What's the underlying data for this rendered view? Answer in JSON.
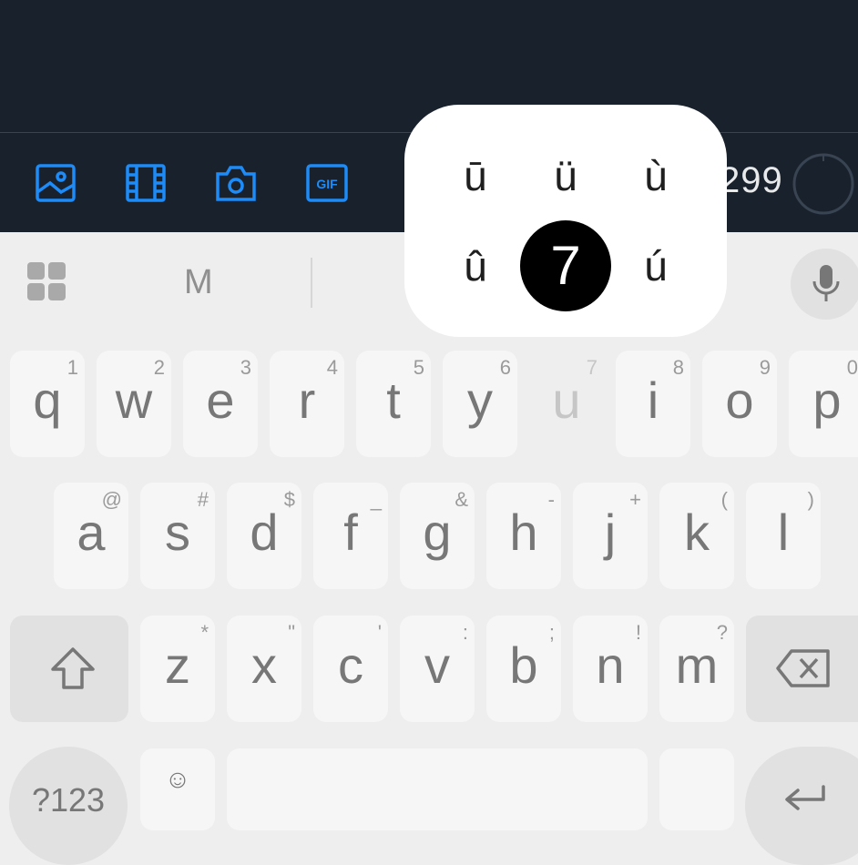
{
  "compose": {
    "char_count": "299",
    "icons": [
      "image-icon",
      "video-icon",
      "camera-icon",
      "gif-icon"
    ],
    "gif_label": "GIF"
  },
  "keyboard": {
    "suggestion": "M",
    "popup": {
      "alternates_top": [
        "ū",
        "ü",
        "ù"
      ],
      "alternates_bottom": [
        "û",
        "7",
        "ú"
      ],
      "selected": "7"
    },
    "row1": [
      {
        "key": "q",
        "hint": "1"
      },
      {
        "key": "w",
        "hint": "2"
      },
      {
        "key": "e",
        "hint": "3"
      },
      {
        "key": "r",
        "hint": "4"
      },
      {
        "key": "t",
        "hint": "5"
      },
      {
        "key": "y",
        "hint": "6"
      },
      {
        "key": "u",
        "hint": "7"
      },
      {
        "key": "i",
        "hint": "8"
      },
      {
        "key": "o",
        "hint": "9"
      },
      {
        "key": "p",
        "hint": "0"
      }
    ],
    "row2": [
      {
        "key": "a",
        "hint": "@"
      },
      {
        "key": "s",
        "hint": "#"
      },
      {
        "key": "d",
        "hint": "$"
      },
      {
        "key": "f",
        "hint": "_"
      },
      {
        "key": "g",
        "hint": "&"
      },
      {
        "key": "h",
        "hint": "-"
      },
      {
        "key": "j",
        "hint": "+"
      },
      {
        "key": "k",
        "hint": "("
      },
      {
        "key": "l",
        "hint": ")"
      }
    ],
    "row3": [
      {
        "key": "z",
        "hint": "*"
      },
      {
        "key": "x",
        "hint": "\""
      },
      {
        "key": "c",
        "hint": "'"
      },
      {
        "key": "v",
        "hint": ":"
      },
      {
        "key": "b",
        "hint": ";"
      },
      {
        "key": "n",
        "hint": "!"
      },
      {
        "key": "m",
        "hint": "?"
      }
    ],
    "symbols_label": "?123",
    "emoji_label": "☺"
  },
  "colors": {
    "compose_bg": "#19212c",
    "accent": "#1d8cf8",
    "keyboard_bg": "#eeeeee"
  }
}
